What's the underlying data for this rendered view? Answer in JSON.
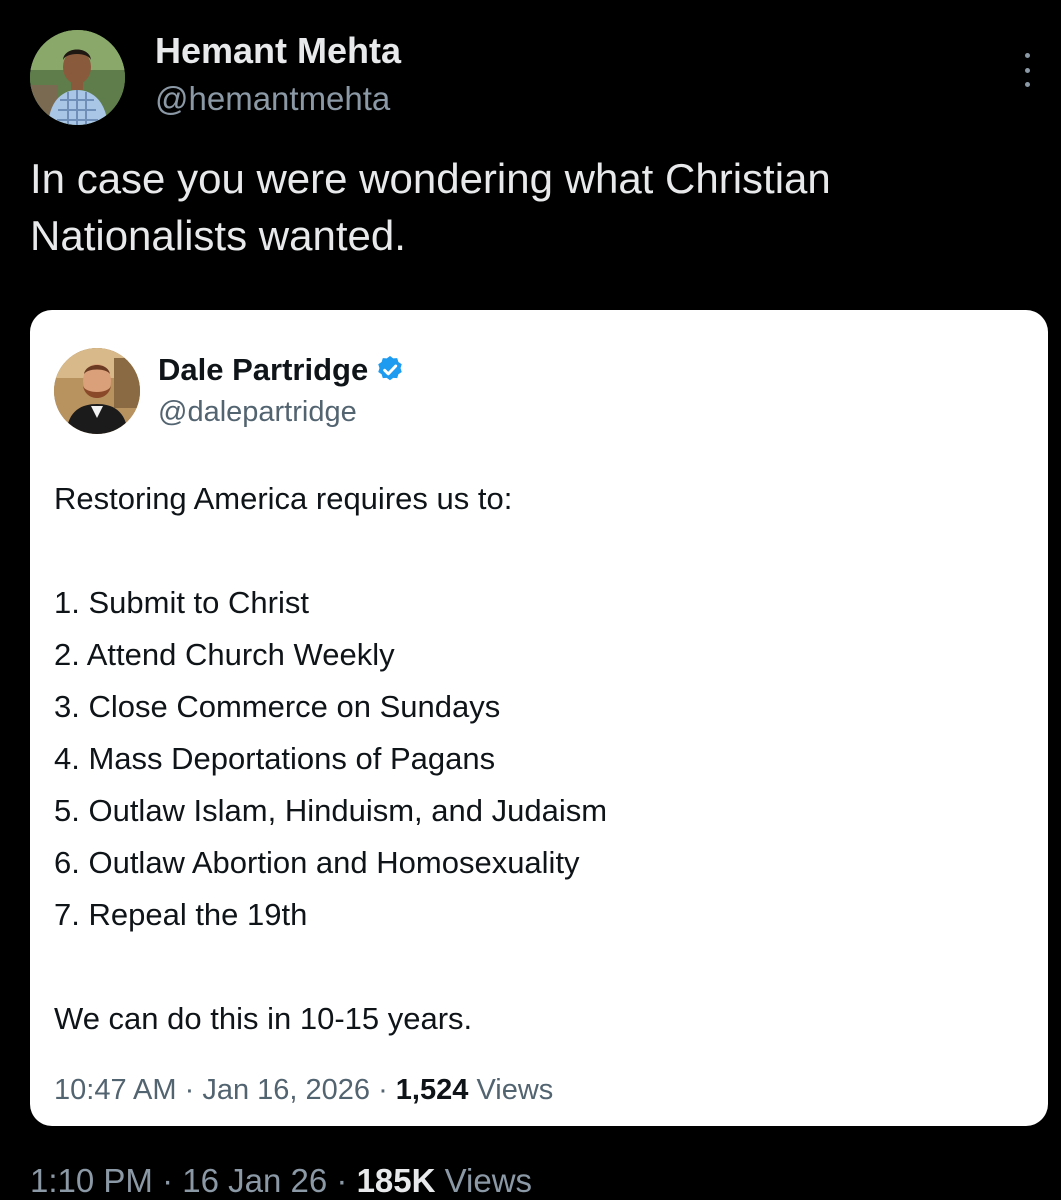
{
  "author": {
    "name": "Hemant Mehta",
    "handle": "@hemantmehta"
  },
  "more_icon": "more-vertical-icon",
  "tweet_text_lines": [
    "In case you were wondering what Christian",
    "Nationalists wanted."
  ],
  "quoted": {
    "name": "Dale Partridge",
    "verified_icon": "verified-badge-icon",
    "verified_color": "#1d9bf0",
    "handle": "@dalepartridge",
    "intro": "Restoring America requires us to:",
    "items": [
      "1. Submit to Christ",
      "2. Attend Church Weekly",
      "3. Close Commerce on Sundays",
      "4. Mass Deportations of Pagans",
      "5. Outlaw Islam, Hinduism, and Judaism",
      "6. Outlaw Abortion and Homosexuality",
      "7. Repeal the 19th"
    ],
    "closing": "We can do this in 10-15 years.",
    "time": "10:47 AM",
    "date": "Jan 16, 2026",
    "views_count": "1,524",
    "views_label": "Views"
  },
  "meta": {
    "time": "1:10 PM",
    "date": "16 Jan 26",
    "views_count": "185K",
    "views_label": "Views"
  }
}
